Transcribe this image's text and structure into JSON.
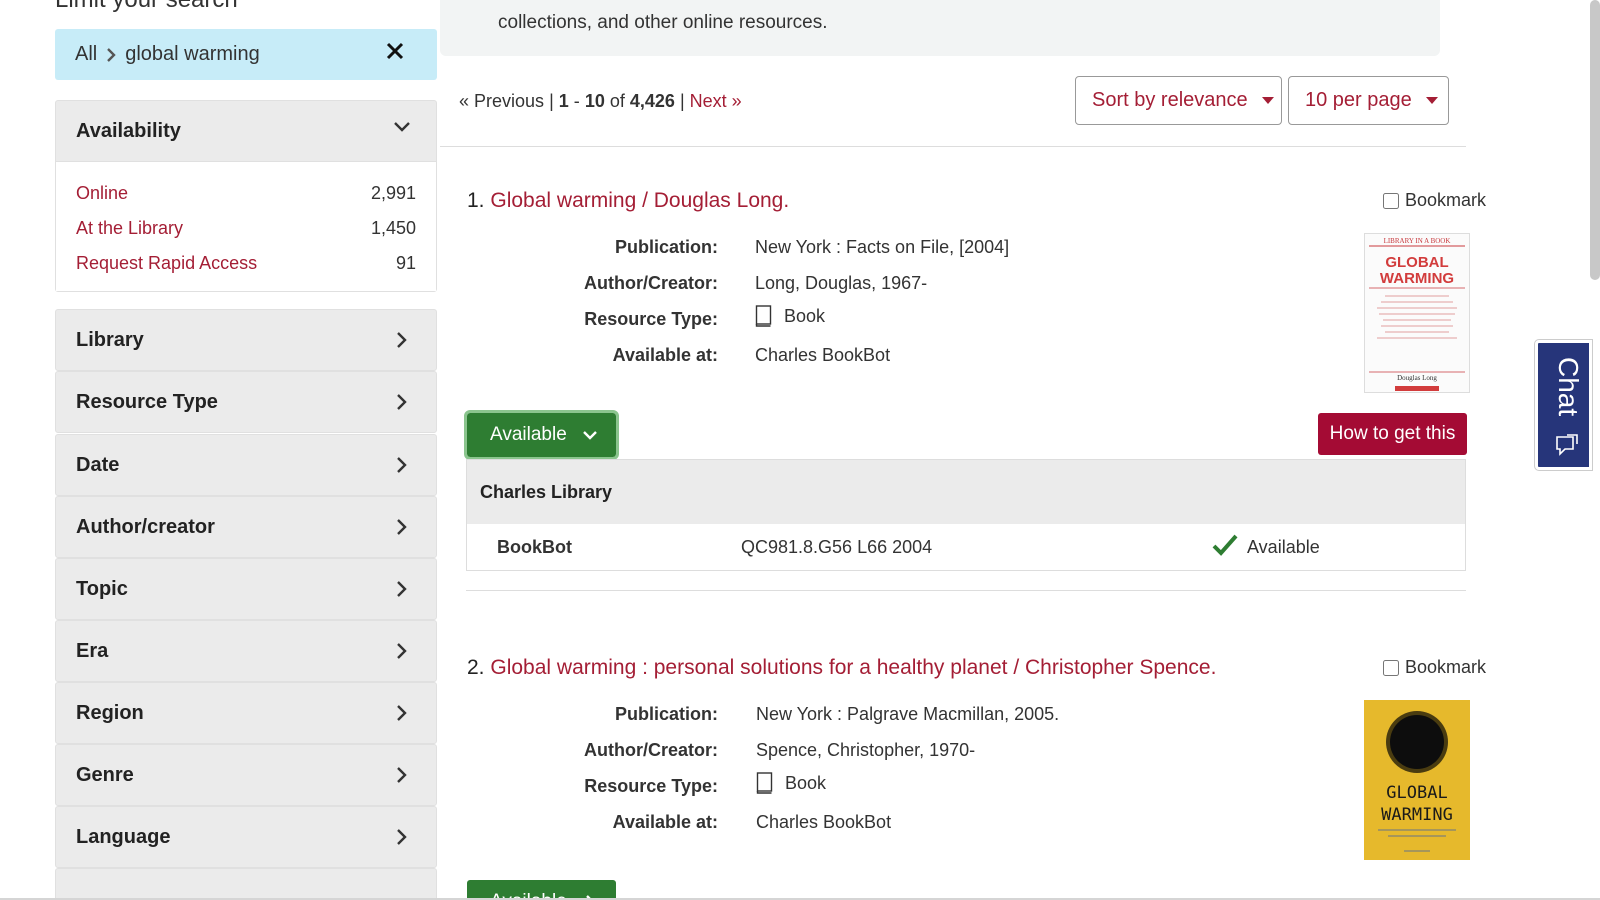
{
  "sidebar": {
    "title": "Limit your search",
    "constraint": {
      "scope": "All",
      "query": "global warming"
    },
    "availability": {
      "label": "Availability",
      "items": [
        {
          "label": "Online",
          "count": "2,991"
        },
        {
          "label": "At the Library",
          "count": "1,450"
        },
        {
          "label": "Request Rapid Access",
          "count": "91"
        }
      ]
    },
    "facets": [
      "Library",
      "Resource Type",
      "Date",
      "Author/creator",
      "Topic",
      "Era",
      "Region",
      "Genre",
      "Language"
    ]
  },
  "intro": {
    "text": "collections, and other online resources."
  },
  "pager": {
    "prev": "« Previous",
    "sep1": "|",
    "start": "1",
    "dash": "-",
    "end": "10",
    "of": "of",
    "total": "4,426",
    "sep2": "|",
    "next": "Next »"
  },
  "sort": {
    "label": "Sort by relevance"
  },
  "per_page": {
    "label": "10 per page"
  },
  "labels": {
    "publication": "Publication:",
    "author": "Author/Creator:",
    "resource_type": "Resource Type:",
    "available_at": "Available at:",
    "bookmark": "Bookmark"
  },
  "results": [
    {
      "number": "1.",
      "title": "Global warming / Douglas Long.",
      "publication": "New York : Facts on File, [2004]",
      "author": "Long, Douglas, 1967-",
      "resource_type": "Book",
      "available_at": "Charles BookBot",
      "availability_button": "Available",
      "how_to": "How to get this",
      "cover": {
        "top": "LIBRARY IN A BOOK",
        "title1": "GLOBAL",
        "title2": "WARMING",
        "author": "Douglas Long"
      },
      "holdings": {
        "library": "Charles Library",
        "location": "BookBot",
        "call_number": "QC981.8.G56 L66 2004",
        "status": "Available"
      }
    },
    {
      "number": "2.",
      "title": "Global warming : personal solutions for a healthy planet / Christopher Spence.",
      "publication": "New York : Palgrave Macmillan, 2005.",
      "author": "Spence, Christopher, 1970-",
      "resource_type": "Book",
      "available_at": "Charles BookBot",
      "availability_button": "Available",
      "cover": {
        "title1": "GLOBAL",
        "title2": "WARMING"
      }
    }
  ],
  "chat": {
    "label": "Chat"
  },
  "colors": {
    "link": "#a41e35",
    "available": "#2e7d32",
    "howto": "#a40b34",
    "chat": "#26357a",
    "constraint": "#c7ecf8"
  }
}
